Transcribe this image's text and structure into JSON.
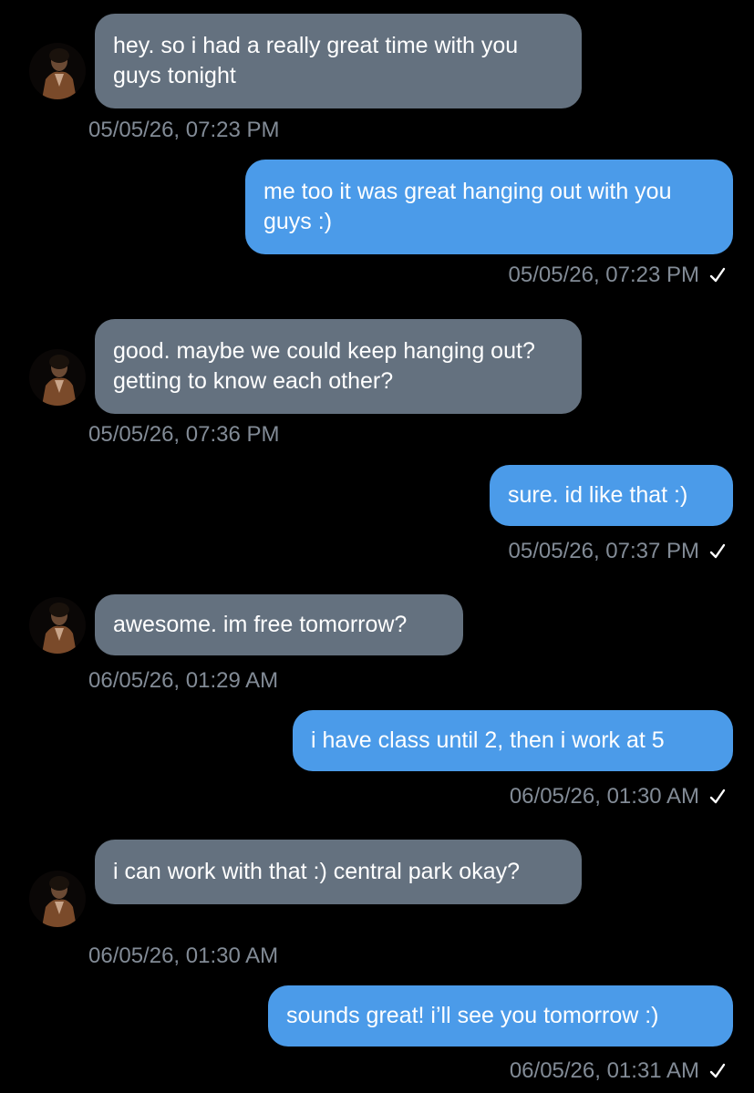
{
  "messages": [
    {
      "direction": "in",
      "text": "hey. so i had a really great time with you guys tonight",
      "time": "05/05/26, 07:23 PM"
    },
    {
      "direction": "out",
      "text": "me too it was great hanging out with you guys :)",
      "time": "05/05/26, 07:23 PM"
    },
    {
      "direction": "in",
      "text": "good. maybe we could keep hanging out? getting to know each other?",
      "time": "05/05/26, 07:36 PM"
    },
    {
      "direction": "out",
      "text": "sure. id like that :)",
      "time": "05/05/26, 07:37 PM"
    },
    {
      "direction": "in",
      "text": "awesome. im free tomorrow?",
      "time": "06/05/26, 01:29 AM"
    },
    {
      "direction": "out",
      "text": "i have class until 2, then i work at 5",
      "time": "06/05/26, 01:30 AM"
    },
    {
      "direction": "in",
      "text": "i can work with that :) central park okay?",
      "time": "06/05/26, 01:30 AM"
    },
    {
      "direction": "out",
      "text": "sounds great! i’ll see you tomorrow :)",
      "time": "06/05/26, 01:31 AM"
    }
  ],
  "colors": {
    "background": "#000000",
    "incoming_bubble": "#64717f",
    "outgoing_bubble": "#4b9be9",
    "timestamp": "#828b96",
    "check": "#ffffff"
  },
  "icons": {
    "read_receipt": "check-icon",
    "avatar": "contact-avatar"
  }
}
